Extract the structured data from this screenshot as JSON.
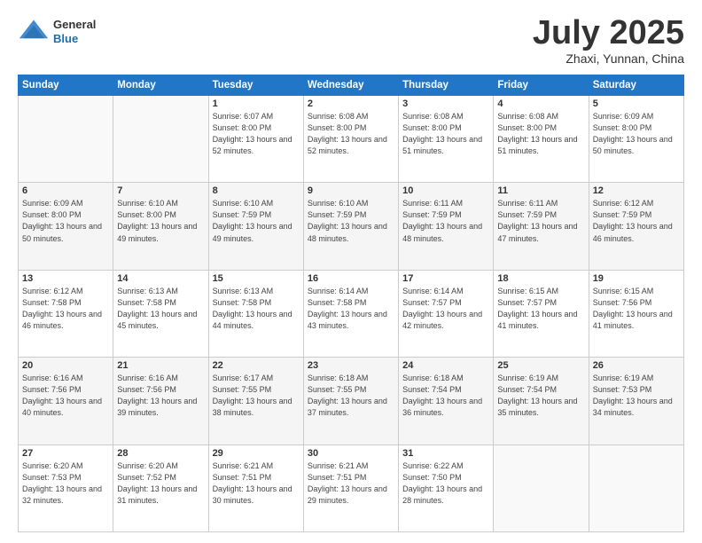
{
  "header": {
    "logo": {
      "general": "General",
      "blue": "Blue"
    },
    "title": "July 2025",
    "location": "Zhaxi, Yunnan, China"
  },
  "weekdays": [
    "Sunday",
    "Monday",
    "Tuesday",
    "Wednesday",
    "Thursday",
    "Friday",
    "Saturday"
  ],
  "weeks": [
    [
      {
        "day": "",
        "info": ""
      },
      {
        "day": "",
        "info": ""
      },
      {
        "day": "1",
        "info": "Sunrise: 6:07 AM\nSunset: 8:00 PM\nDaylight: 13 hours and 52 minutes."
      },
      {
        "day": "2",
        "info": "Sunrise: 6:08 AM\nSunset: 8:00 PM\nDaylight: 13 hours and 52 minutes."
      },
      {
        "day": "3",
        "info": "Sunrise: 6:08 AM\nSunset: 8:00 PM\nDaylight: 13 hours and 51 minutes."
      },
      {
        "day": "4",
        "info": "Sunrise: 6:08 AM\nSunset: 8:00 PM\nDaylight: 13 hours and 51 minutes."
      },
      {
        "day": "5",
        "info": "Sunrise: 6:09 AM\nSunset: 8:00 PM\nDaylight: 13 hours and 50 minutes."
      }
    ],
    [
      {
        "day": "6",
        "info": "Sunrise: 6:09 AM\nSunset: 8:00 PM\nDaylight: 13 hours and 50 minutes."
      },
      {
        "day": "7",
        "info": "Sunrise: 6:10 AM\nSunset: 8:00 PM\nDaylight: 13 hours and 49 minutes."
      },
      {
        "day": "8",
        "info": "Sunrise: 6:10 AM\nSunset: 7:59 PM\nDaylight: 13 hours and 49 minutes."
      },
      {
        "day": "9",
        "info": "Sunrise: 6:10 AM\nSunset: 7:59 PM\nDaylight: 13 hours and 48 minutes."
      },
      {
        "day": "10",
        "info": "Sunrise: 6:11 AM\nSunset: 7:59 PM\nDaylight: 13 hours and 48 minutes."
      },
      {
        "day": "11",
        "info": "Sunrise: 6:11 AM\nSunset: 7:59 PM\nDaylight: 13 hours and 47 minutes."
      },
      {
        "day": "12",
        "info": "Sunrise: 6:12 AM\nSunset: 7:59 PM\nDaylight: 13 hours and 46 minutes."
      }
    ],
    [
      {
        "day": "13",
        "info": "Sunrise: 6:12 AM\nSunset: 7:58 PM\nDaylight: 13 hours and 46 minutes."
      },
      {
        "day": "14",
        "info": "Sunrise: 6:13 AM\nSunset: 7:58 PM\nDaylight: 13 hours and 45 minutes."
      },
      {
        "day": "15",
        "info": "Sunrise: 6:13 AM\nSunset: 7:58 PM\nDaylight: 13 hours and 44 minutes."
      },
      {
        "day": "16",
        "info": "Sunrise: 6:14 AM\nSunset: 7:58 PM\nDaylight: 13 hours and 43 minutes."
      },
      {
        "day": "17",
        "info": "Sunrise: 6:14 AM\nSunset: 7:57 PM\nDaylight: 13 hours and 42 minutes."
      },
      {
        "day": "18",
        "info": "Sunrise: 6:15 AM\nSunset: 7:57 PM\nDaylight: 13 hours and 41 minutes."
      },
      {
        "day": "19",
        "info": "Sunrise: 6:15 AM\nSunset: 7:56 PM\nDaylight: 13 hours and 41 minutes."
      }
    ],
    [
      {
        "day": "20",
        "info": "Sunrise: 6:16 AM\nSunset: 7:56 PM\nDaylight: 13 hours and 40 minutes."
      },
      {
        "day": "21",
        "info": "Sunrise: 6:16 AM\nSunset: 7:56 PM\nDaylight: 13 hours and 39 minutes."
      },
      {
        "day": "22",
        "info": "Sunrise: 6:17 AM\nSunset: 7:55 PM\nDaylight: 13 hours and 38 minutes."
      },
      {
        "day": "23",
        "info": "Sunrise: 6:18 AM\nSunset: 7:55 PM\nDaylight: 13 hours and 37 minutes."
      },
      {
        "day": "24",
        "info": "Sunrise: 6:18 AM\nSunset: 7:54 PM\nDaylight: 13 hours and 36 minutes."
      },
      {
        "day": "25",
        "info": "Sunrise: 6:19 AM\nSunset: 7:54 PM\nDaylight: 13 hours and 35 minutes."
      },
      {
        "day": "26",
        "info": "Sunrise: 6:19 AM\nSunset: 7:53 PM\nDaylight: 13 hours and 34 minutes."
      }
    ],
    [
      {
        "day": "27",
        "info": "Sunrise: 6:20 AM\nSunset: 7:53 PM\nDaylight: 13 hours and 32 minutes."
      },
      {
        "day": "28",
        "info": "Sunrise: 6:20 AM\nSunset: 7:52 PM\nDaylight: 13 hours and 31 minutes."
      },
      {
        "day": "29",
        "info": "Sunrise: 6:21 AM\nSunset: 7:51 PM\nDaylight: 13 hours and 30 minutes."
      },
      {
        "day": "30",
        "info": "Sunrise: 6:21 AM\nSunset: 7:51 PM\nDaylight: 13 hours and 29 minutes."
      },
      {
        "day": "31",
        "info": "Sunrise: 6:22 AM\nSunset: 7:50 PM\nDaylight: 13 hours and 28 minutes."
      },
      {
        "day": "",
        "info": ""
      },
      {
        "day": "",
        "info": ""
      }
    ]
  ]
}
